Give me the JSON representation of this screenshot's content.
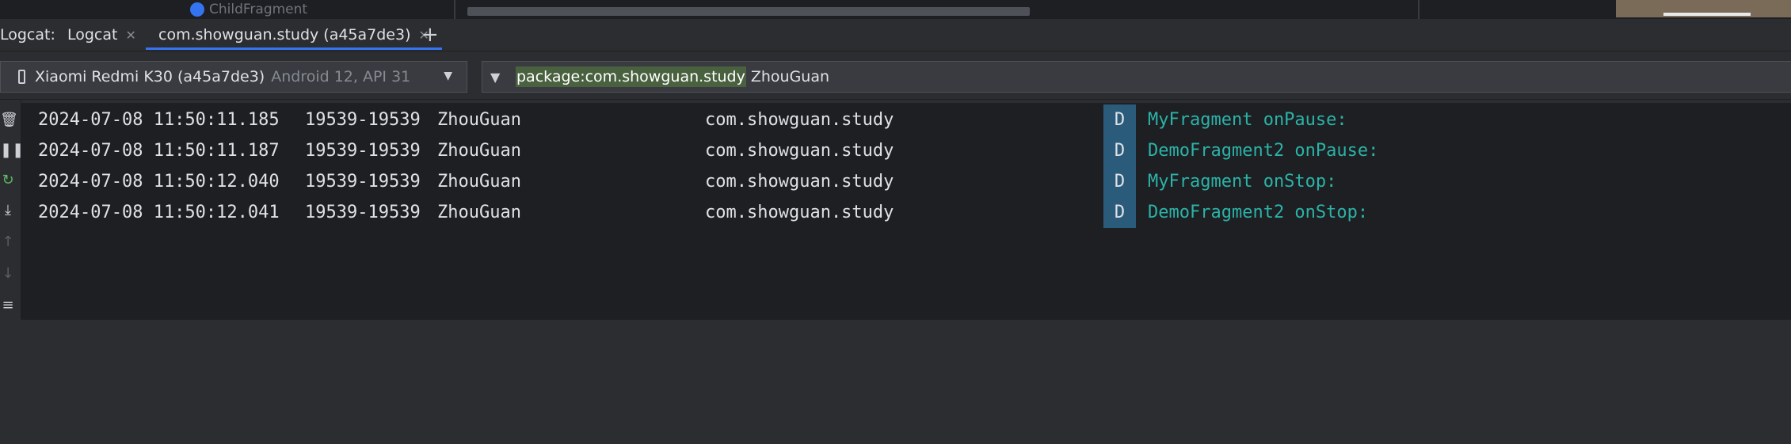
{
  "top_strip": {
    "crumb_text": "ChildFragment",
    "crumb_icon": "class-icon"
  },
  "tool_window": {
    "name": "Logcat:",
    "tabs": [
      {
        "label": "Logcat",
        "active": false
      },
      {
        "label": "com.showguan.study (a45a7de3)",
        "active": true
      }
    ],
    "add_tab": "+"
  },
  "device_selector": {
    "device": "Xiaomi Redmi K30 (a45a7de3)",
    "details": "Android 12, API 31",
    "icon": "phone-icon"
  },
  "filter": {
    "highlighted": "package:com.showguan.study",
    "rest": "ZhouGuan",
    "icon": "filter-icon"
  },
  "sidebar_icons": [
    "trash-icon",
    "pause-icon",
    "restart-icon",
    "scroll-to-end-icon",
    "up-arrow-icon",
    "down-arrow-icon",
    "soft-wrap-icon"
  ],
  "log": {
    "rows": [
      {
        "timestamp": "2024-07-08 11:50:11.185",
        "pid": "19539-19539",
        "tag": "ZhouGuan",
        "package": "com.showguan.study",
        "level": "D",
        "message": "MyFragment onPause:"
      },
      {
        "timestamp": "2024-07-08 11:50:11.187",
        "pid": "19539-19539",
        "tag": "ZhouGuan",
        "package": "com.showguan.study",
        "level": "D",
        "message": "DemoFragment2 onPause:"
      },
      {
        "timestamp": "2024-07-08 11:50:12.040",
        "pid": "19539-19539",
        "tag": "ZhouGuan",
        "package": "com.showguan.study",
        "level": "D",
        "message": "MyFragment onStop:"
      },
      {
        "timestamp": "2024-07-08 11:50:12.041",
        "pid": "19539-19539",
        "tag": "ZhouGuan",
        "package": "com.showguan.study",
        "level": "D",
        "message": "DemoFragment2 onStop:"
      }
    ]
  },
  "colors": {
    "accent": "#3574f0",
    "level_debug_bg": "#2b5b7a",
    "message": "#2bb3a8",
    "filter_highlight": "#49613e"
  }
}
